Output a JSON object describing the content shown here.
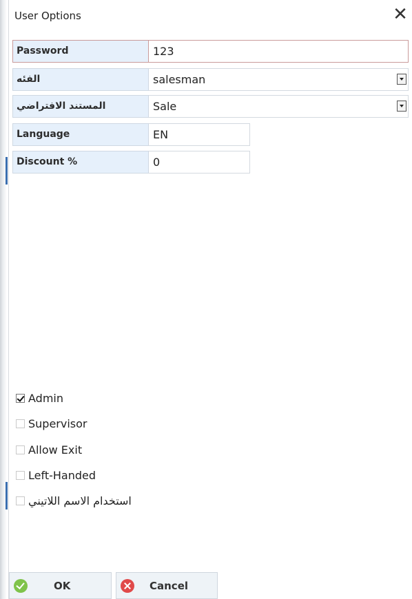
{
  "window": {
    "title": "User Options",
    "close_glyph": "✕"
  },
  "fields": [
    {
      "label": "Password",
      "value": "123",
      "type": "text"
    },
    {
      "label": "الفئه",
      "value": "salesman",
      "type": "select"
    },
    {
      "label": "المستند الافتراضي",
      "value": "Sale",
      "type": "select"
    },
    {
      "label": "Language",
      "value": "EN",
      "type": "text"
    },
    {
      "label": "Discount %",
      "value": "0",
      "type": "text"
    }
  ],
  "checkboxes": [
    {
      "label": "Admin",
      "checked": true
    },
    {
      "label": "Supervisor",
      "checked": false
    },
    {
      "label": "Allow Exit",
      "checked": false
    },
    {
      "label": "Left-Handed",
      "checked": false
    },
    {
      "label": "استخدام الاسم اللاتيني",
      "checked": false
    }
  ],
  "buttons": {
    "ok_label": "OK",
    "cancel_label": "Cancel"
  },
  "colors": {
    "label_bg": "#e6f0fb",
    "ok_icon": "#7fc34b",
    "cancel_icon": "#e04a4a"
  },
  "icons": {
    "ok": "check-circle-icon",
    "cancel": "x-circle-icon",
    "dropdown": "chevron-down-icon"
  }
}
